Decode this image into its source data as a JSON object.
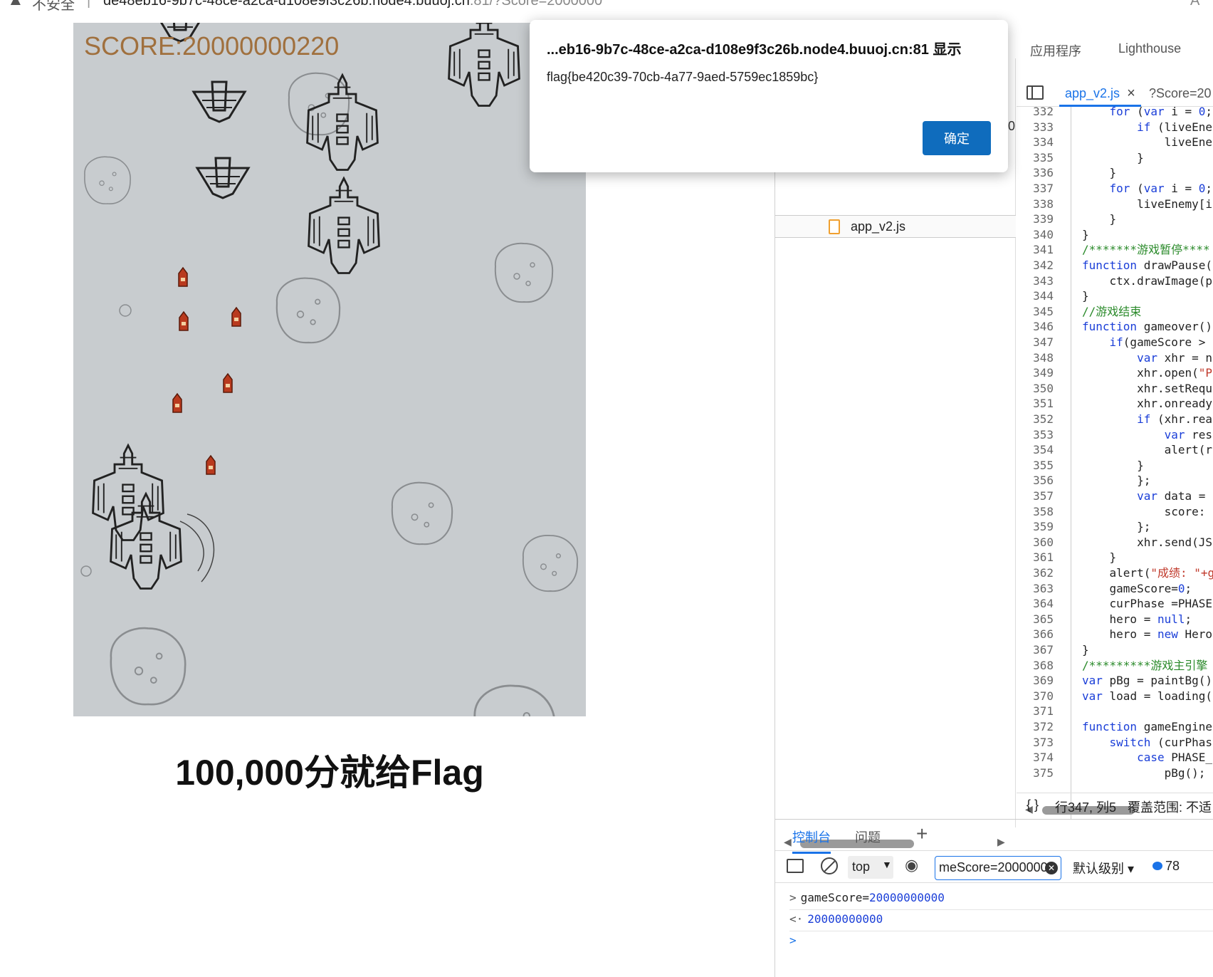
{
  "browser": {
    "insecure_label": "不安全",
    "url_main": "de48eb16-9b7c-48ce-a2ca-d108e9f3c26b.node4.buuoj.cn",
    "url_rest": ":81/?Score=2000000",
    "font_button": "A\""
  },
  "game": {
    "score_text": "SCORE:20000000220",
    "background": "#c8cccf",
    "caption": "100,000分就给Flag"
  },
  "dialog": {
    "title": "...eb16-9b7c-48ce-a2ca-d108e9f3c26b.node4.buuoj.cn:81 显示",
    "message": "flag{be420c39-70cb-4a77-9aed-5759ec1859bc}",
    "ok_label": "确定"
  },
  "devtools": {
    "tabs": [
      "应用程序",
      "Lighthouse"
    ],
    "file_item": "app_v2.js",
    "partial_digit": "0",
    "editor_tabs": [
      "app_v2.js",
      "?Score=20"
    ],
    "status": {
      "braces": "{ }",
      "position": "行347, 列5",
      "coverage": "覆盖范围: 不适"
    },
    "code_lines": [
      {
        "n": "332",
        "t": "    for (var i = 0;"
      },
      {
        "n": "333",
        "t": "        if (liveEne"
      },
      {
        "n": "334",
        "t": "            liveEne"
      },
      {
        "n": "335",
        "t": "        }"
      },
      {
        "n": "336",
        "t": "    }"
      },
      {
        "n": "337",
        "t": "    for (var i = 0;"
      },
      {
        "n": "338",
        "t": "        liveEnemy[i"
      },
      {
        "n": "339",
        "t": "    }"
      },
      {
        "n": "340",
        "t": "}"
      },
      {
        "n": "341",
        "t": "/*******游戏暂停****"
      },
      {
        "n": "342",
        "t": "function drawPause("
      },
      {
        "n": "343",
        "t": "    ctx.drawImage(p"
      },
      {
        "n": "344",
        "t": "}"
      },
      {
        "n": "345",
        "t": "//游戏结束"
      },
      {
        "n": "346",
        "t": "function gameover()"
      },
      {
        "n": "347",
        "t": "    if(gameScore >"
      },
      {
        "n": "348",
        "t": "        var xhr = n"
      },
      {
        "n": "349",
        "t": "        xhr.open(\"P"
      },
      {
        "n": "350",
        "t": "        xhr.setRequ"
      },
      {
        "n": "351",
        "t": "        xhr.onready"
      },
      {
        "n": "352",
        "t": "        if (xhr.rea"
      },
      {
        "n": "353",
        "t": "            var res"
      },
      {
        "n": "354",
        "t": "            alert(r"
      },
      {
        "n": "355",
        "t": "        }"
      },
      {
        "n": "356",
        "t": "        };"
      },
      {
        "n": "357",
        "t": "        var data ="
      },
      {
        "n": "358",
        "t": "            score:"
      },
      {
        "n": "359",
        "t": "        };"
      },
      {
        "n": "360",
        "t": "        xhr.send(JS"
      },
      {
        "n": "361",
        "t": "    }"
      },
      {
        "n": "362",
        "t": "    alert(\"成绩: \"+g"
      },
      {
        "n": "363",
        "t": "    gameScore=0;"
      },
      {
        "n": "364",
        "t": "    curPhase =PHASE"
      },
      {
        "n": "365",
        "t": "    hero = null;"
      },
      {
        "n": "366",
        "t": "    hero = new Hero"
      },
      {
        "n": "367",
        "t": "}"
      },
      {
        "n": "368",
        "t": "/*********游戏主引擎"
      },
      {
        "n": "369",
        "t": "var pBg = paintBg()"
      },
      {
        "n": "370",
        "t": "var load = loading("
      },
      {
        "n": "371",
        "t": ""
      },
      {
        "n": "372",
        "t": "function gameEngine"
      },
      {
        "n": "373",
        "t": "    switch (curPhas"
      },
      {
        "n": "374",
        "t": "        case PHASE_"
      },
      {
        "n": "375",
        "t": "            pBg();"
      }
    ]
  },
  "console": {
    "tabs": [
      "控制台",
      "问题"
    ],
    "context": "top",
    "filter_value": "meScore=2000000",
    "level": "默认级别",
    "message_count": "78",
    "entries": [
      {
        "prefix": ">",
        "text": "gameScore=",
        "value": "20000000000"
      },
      {
        "prefix": "<·",
        "text": "",
        "value": "20000000000"
      }
    ],
    "prompt": ">"
  }
}
